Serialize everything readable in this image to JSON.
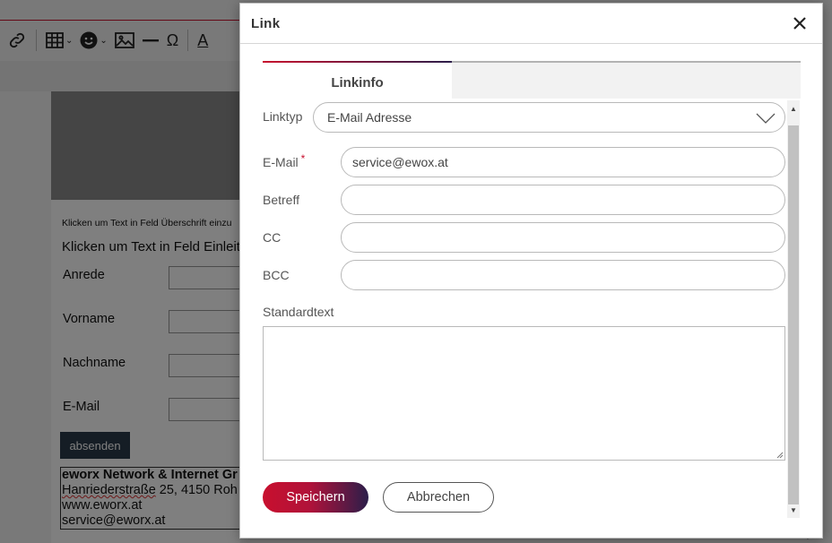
{
  "background": {
    "heading": "Klicken um Text in Feld Überschrift einzu",
    "intro": "Klicken um Text in Feld Einleit",
    "form_labels": [
      "Anrede",
      "Vorname",
      "Nachname",
      "E-Mail"
    ],
    "submit_label": "absenden",
    "footer": {
      "company": "eworx Network & Internet Gr",
      "street_prefix": "Hanriederstraße",
      "street_rest": " 25, 4150 Roh",
      "web": "www.eworx.at",
      "email": "service@eworx.at"
    },
    "toolbar_icons": [
      "link-icon",
      "table-icon",
      "emoji-icon",
      "image-icon",
      "horizontal-line-icon",
      "omega-icon",
      "text-color-icon"
    ],
    "toolbar_glyphs": {
      "omega": "Ω",
      "text_color": "A",
      "caret": "⌄"
    }
  },
  "dialog": {
    "title": "Link",
    "tab": "Linkinfo",
    "link_type": {
      "label": "Linktyp",
      "value": "E-Mail Adresse"
    },
    "email": {
      "label": "E-Mail",
      "required_mark": "*",
      "value": "service@ewox.at"
    },
    "subject": {
      "label": "Betreff",
      "value": ""
    },
    "cc": {
      "label": "CC",
      "value": ""
    },
    "bcc": {
      "label": "BCC",
      "value": ""
    },
    "body": {
      "label": "Standardtext",
      "value": ""
    },
    "save_label": "Speichern",
    "cancel_label": "Abbrechen"
  },
  "colors": {
    "accent": "#c8102e",
    "accent_dark": "#2b1e4a"
  }
}
